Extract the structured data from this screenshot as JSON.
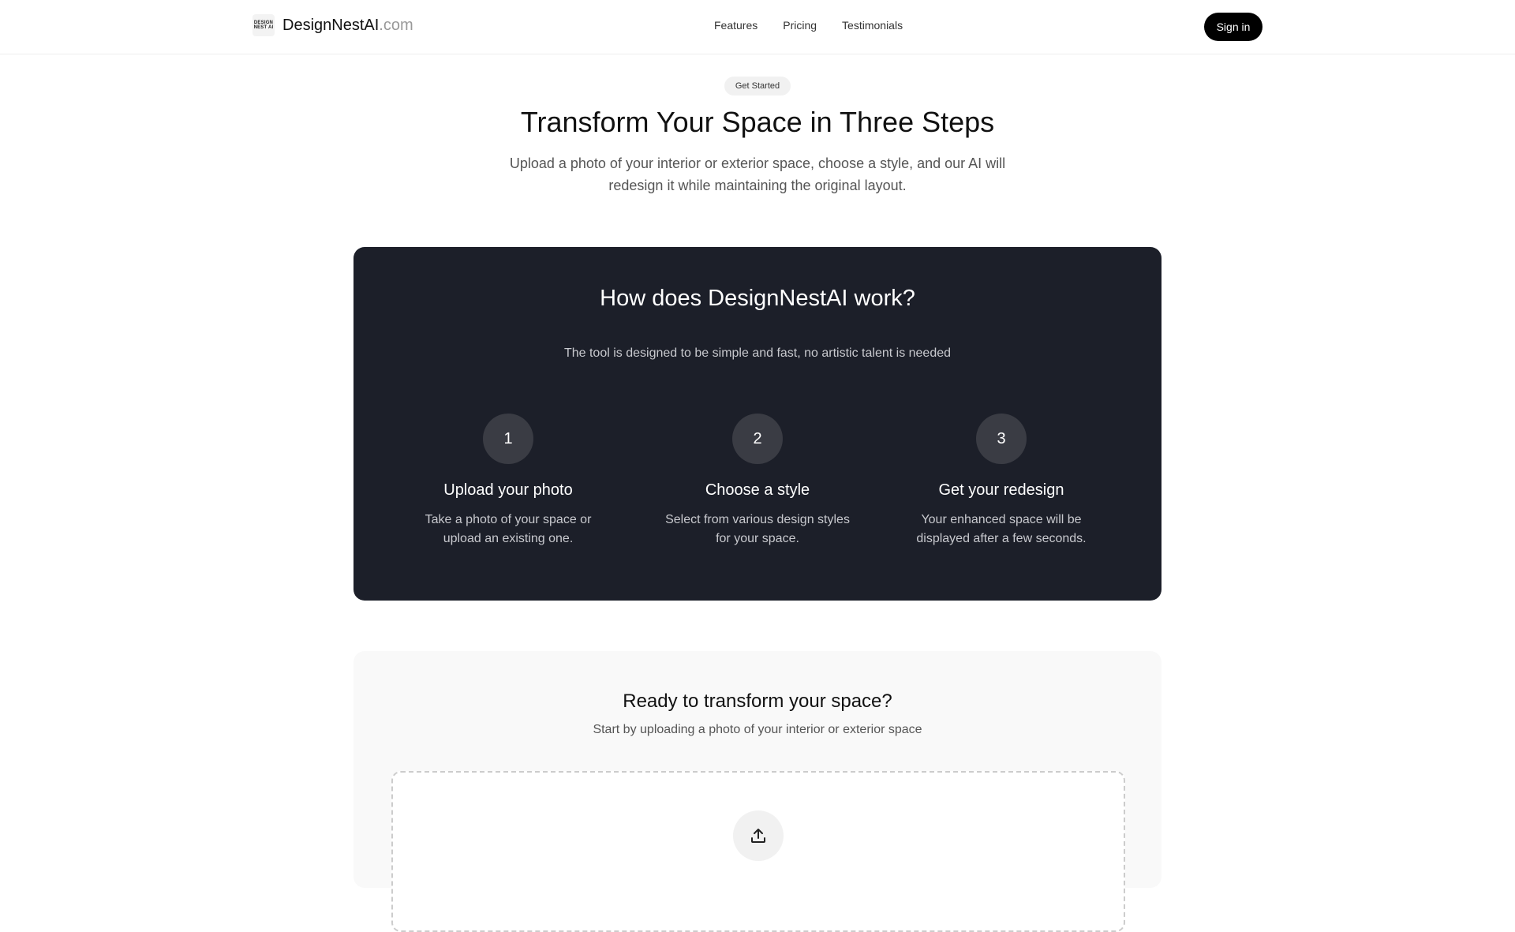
{
  "header": {
    "logo_text_line1": "DESIGN",
    "logo_text_line2": "NEST AI",
    "brand_name": "DesignNestAI",
    "brand_tld": ".com",
    "nav": [
      {
        "label": "Features"
      },
      {
        "label": "Pricing"
      },
      {
        "label": "Testimonials"
      }
    ],
    "signin_label": "Sign in"
  },
  "hero": {
    "badge": "Get Started",
    "title": "Transform Your Space in Three Steps",
    "subtitle": "Upload a photo of your interior or exterior space, choose a style, and our AI will redesign it while maintaining the original layout."
  },
  "how": {
    "title": "How does DesignNestAI work?",
    "subtitle": "The tool is designed to be simple and fast, no artistic talent is needed",
    "steps": [
      {
        "num": "1",
        "title": "Upload your photo",
        "desc": "Take a photo of your space or upload an existing one."
      },
      {
        "num": "2",
        "title": "Choose a style",
        "desc": "Select from various design styles for your space."
      },
      {
        "num": "3",
        "title": "Get your redesign",
        "desc": "Your enhanced space will be displayed after a few seconds."
      }
    ]
  },
  "cta": {
    "title": "Ready to transform your space?",
    "subtitle": "Start by uploading a photo of your interior or exterior space",
    "upload_icon": "upload-icon"
  },
  "colors": {
    "dark_card": "#1c1f29",
    "step_circle": "#3a3c44",
    "signin_bg": "#000000"
  }
}
